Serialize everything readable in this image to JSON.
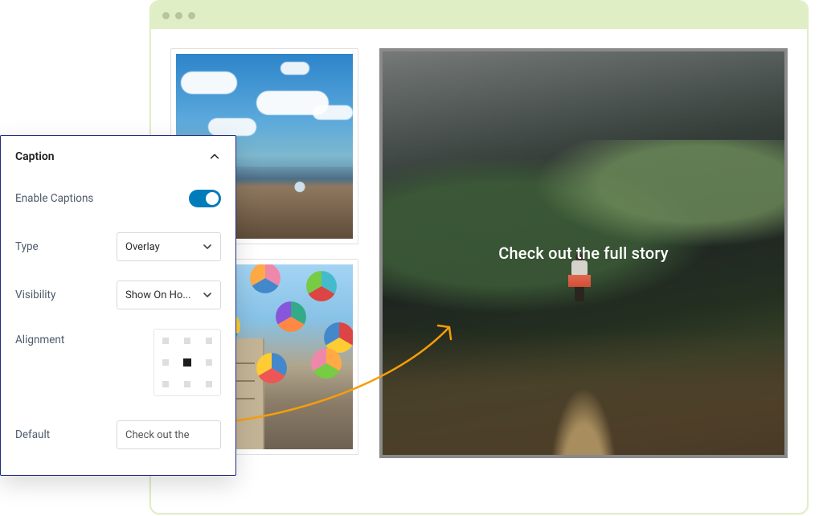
{
  "panel": {
    "title": "Caption",
    "enable_label": "Enable Captions",
    "type_label": "Type",
    "type_value": "Overlay",
    "visibility_label": "Visibility",
    "visibility_value": "Show On Ho...",
    "alignment_label": "Alignment",
    "default_label": "Default",
    "default_value": "Check out the",
    "alignment_selected": "center"
  },
  "overlay": {
    "caption_text": "Check out the full story"
  }
}
